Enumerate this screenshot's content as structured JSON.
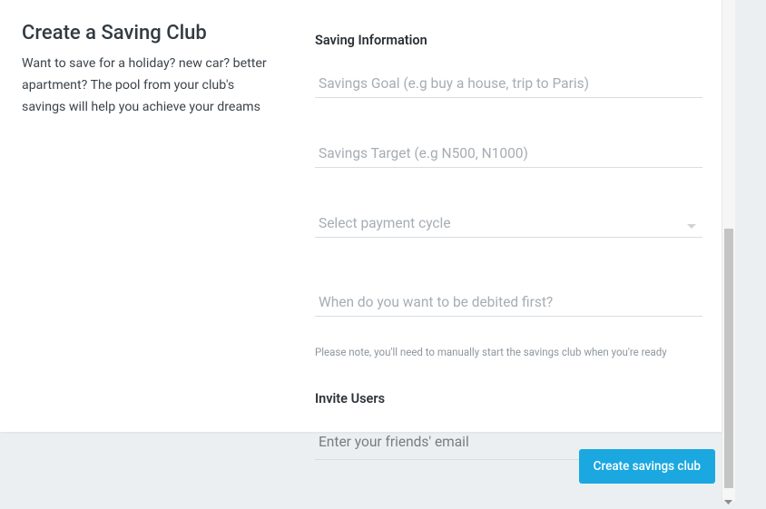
{
  "left": {
    "title": "Create a Saving Club",
    "description": "Want to save for a holiday? new car? better apartment? The pool from your club's savings will help you achieve your dreams"
  },
  "form": {
    "section_heading": "Saving Information",
    "goal_placeholder": "Savings Goal (e.g buy a house, trip to Paris)",
    "target_placeholder": "Savings Target (e.g N500, N1000)",
    "cycle_placeholder": "Select payment cycle",
    "debit_placeholder": "When do you want to be debited first?",
    "note": "Please note, you'll need to manually start the savings club when you're ready",
    "invite_heading": "Invite Users",
    "invite_placeholder": "Enter your friends' email"
  },
  "footer": {
    "submit_label": "Create savings club"
  }
}
